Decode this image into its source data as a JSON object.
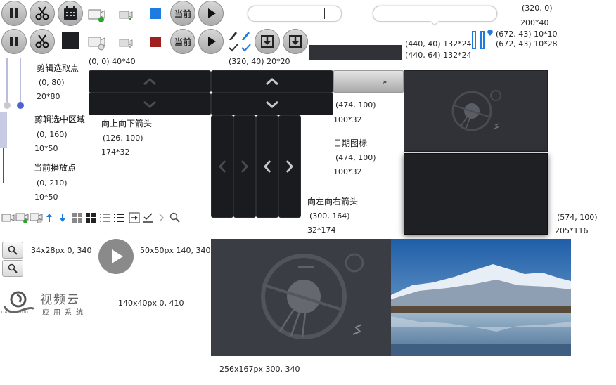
{
  "current_label": "当前",
  "labels": {
    "coord_320_0": "(320, 0)",
    "size_200x40": "200*40",
    "coord_440_40_size": "(440, 40)  132*24",
    "coord_440_64_size": "(440, 64)  132*24",
    "coord_672_43_10": "(672, 43)  10*10",
    "coord_672_43_28": "(672, 43)  10*28",
    "coord_00_4040": "(0, 0)  40*40",
    "coord_320_40_2020": "(320, 40)  20*20",
    "clip_select_point": "剪辑选取点",
    "coord_0_80": "(0, 80)",
    "size_20x80": "20*80",
    "clip_select_area": "剪辑选中区域",
    "coord_0_160": "(0, 160)",
    "size_10x50_a": "10*50",
    "current_play_point": "当前播放点",
    "coord_0_210": "(0, 210)",
    "size_10x50_b": "10*50",
    "updown_arrow": "向上向下箭头",
    "coord_126_100": "(126, 100)",
    "size_174x32": "174*32",
    "coord_474_100_a": "(474, 100)",
    "size_100x32_a": "100*32",
    "date_icon": "日期图标",
    "coord_474_100_b": "(474, 100)",
    "size_100x32_b": "100*32",
    "leftright_arrow": "向左向右箭头",
    "coord_300_164": "(300, 164)",
    "size_32x174": "32*174",
    "coord_574_100": "(574, 100)",
    "size_205x116": "205*116",
    "search_spec": "34x28px  0, 340",
    "play_spec": "50x50px  140, 340",
    "logo_spec": "140x40px  0, 410",
    "poster_spec": "256x167px  300, 340",
    "logo_cn": "视频云",
    "logo_sub": "应用系统",
    "logo_brand": "DAS-CLOUD"
  },
  "next_button": "»",
  "colors": {
    "dark_tile": "#1f2024",
    "dark_panel": "#303238",
    "poster_bg": "#3a3d44",
    "blue": "#1e7be0",
    "red": "#a02020",
    "green": "#2ca52c"
  },
  "icons": [
    "pause-icon",
    "scissors-icon",
    "calendar-icon",
    "video-add-icon",
    "video-arrow-icon",
    "stop-icon",
    "play-icon",
    "pencil-icon",
    "check-icon",
    "download-icon",
    "chevron-up-icon",
    "chevron-down-icon",
    "chevron-left-icon",
    "chevron-right-icon",
    "search-icon",
    "grid-icon",
    "list-icon",
    "bracket-icon",
    "planet-icon",
    "mountain-photo"
  ]
}
